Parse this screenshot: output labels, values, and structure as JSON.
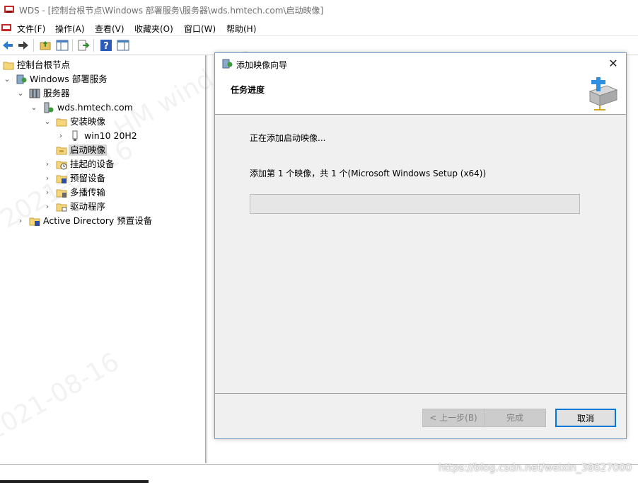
{
  "window": {
    "title": "WDS - [控制台根节点\\Windows 部署服务\\服务器\\wds.hmtech.com\\启动映像]",
    "app_icon": "wds-app-icon"
  },
  "menubar": {
    "items": [
      "文件(F)",
      "操作(A)",
      "查看(V)",
      "收藏夹(O)",
      "窗口(W)",
      "帮助(H)"
    ]
  },
  "toolbar": {
    "buttons": [
      "back-icon",
      "forward-icon",
      "up-folder-icon",
      "show-hide-tree-icon",
      "export-list-icon",
      "help-icon",
      "show-action-pane-icon"
    ]
  },
  "tree": {
    "items": [
      {
        "label": "控制台根节点",
        "icon": "folder-icon",
        "twisty": ""
      },
      {
        "label": "Windows 部署服务",
        "icon": "wds-icon",
        "twisty": "expanded"
      },
      {
        "label": "服务器",
        "icon": "servers-icon",
        "twisty": "expanded"
      },
      {
        "label": "wds.hmtech.com",
        "icon": "server-icon",
        "twisty": "expanded"
      },
      {
        "label": "安装映像",
        "icon": "folder-icon",
        "twisty": "expanded"
      },
      {
        "label": "win10 20H2",
        "icon": "image-group-icon",
        "twisty": "collapsed"
      },
      {
        "label": "启动映像",
        "icon": "boot-folder-icon",
        "twisty": "",
        "selected": true
      },
      {
        "label": "挂起的设备",
        "icon": "pending-devices-icon",
        "twisty": "collapsed"
      },
      {
        "label": "预留设备",
        "icon": "reserved-devices-icon",
        "twisty": "collapsed"
      },
      {
        "label": "多播传输",
        "icon": "multicast-icon",
        "twisty": "collapsed"
      },
      {
        "label": "驱动程序",
        "icon": "drivers-icon",
        "twisty": "collapsed"
      },
      {
        "label": "Active Directory 预置设备",
        "icon": "ad-prestaged-icon",
        "twisty": "collapsed"
      }
    ]
  },
  "dialog": {
    "title": "添加映像向导",
    "close": "✕",
    "step_title": "任务进度",
    "status": "正在添加启动映像...",
    "detail": "添加第 1 个映像，共 1 个(Microsoft Windows Setup (x64))",
    "progress_percent": 0,
    "buttons": {
      "back": "< 上一步(B)",
      "finish": "完成",
      "cancel": "取消"
    }
  },
  "watermark": {
    "date": "2021-08-16",
    "author": "HM  wind.luo",
    "url": "https://blog.csdn.net/weixin_38627000"
  },
  "colors": {
    "accent": "#0078d7",
    "dialog_bg": "#f0f0f0",
    "selected_bg": "#d9d9d9"
  }
}
